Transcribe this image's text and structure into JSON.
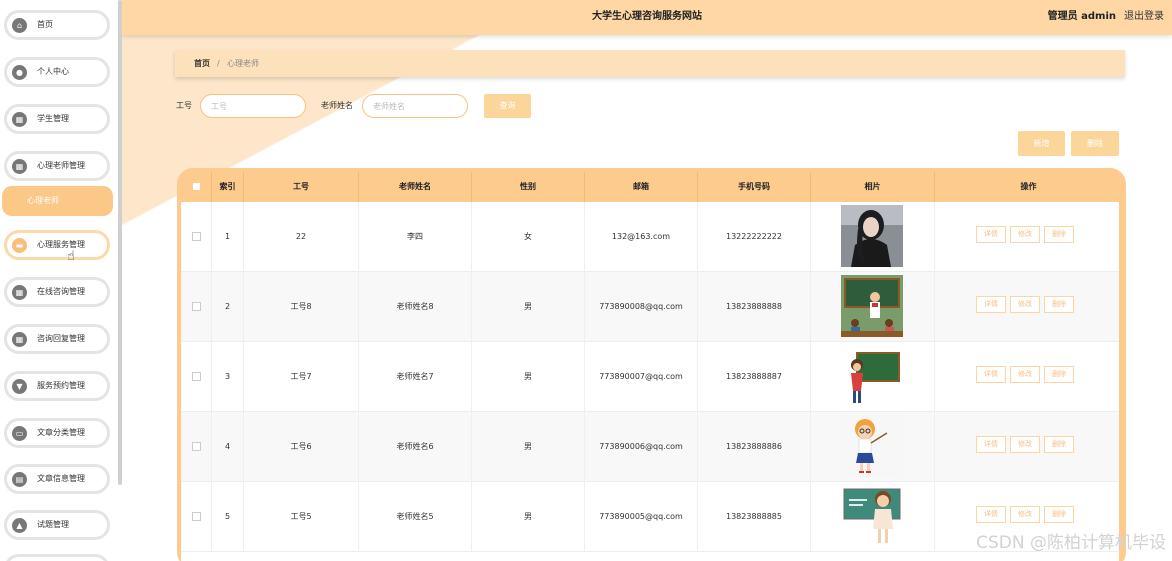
{
  "header": {
    "site_title": "大学生心理咨询服务网站",
    "admin_label": "管理员 admin",
    "logout": "退出登录"
  },
  "sidebar": {
    "items": [
      {
        "label": "首页",
        "icon": "home-icon"
      },
      {
        "label": "个人中心",
        "icon": "user-icon"
      },
      {
        "label": "学生管理",
        "icon": "grid-icon"
      },
      {
        "label": "心理老师管理",
        "icon": "grid-icon"
      },
      {
        "label": "心理服务管理",
        "icon": "chat-icon"
      },
      {
        "label": "在线咨询管理",
        "icon": "grid-icon"
      },
      {
        "label": "咨询回复管理",
        "icon": "grid-icon"
      },
      {
        "label": "服务预约管理",
        "icon": "filter-icon"
      },
      {
        "label": "文章分类管理",
        "icon": "briefcase-icon"
      },
      {
        "label": "文章信息管理",
        "icon": "document-icon"
      },
      {
        "label": "试题管理",
        "icon": "thumb-up-icon"
      }
    ],
    "sub_item": "心理老师"
  },
  "breadcrumb": {
    "home": "首页",
    "separator": "/",
    "current": "心理老师"
  },
  "search": {
    "id_label": "工号",
    "id_placeholder": "工号",
    "name_label": "老师姓名",
    "name_placeholder": "老师姓名",
    "search_button": "查询"
  },
  "toolbar": {
    "add_button": "新增",
    "delete_button": "删除"
  },
  "table": {
    "columns": [
      "索引",
      "工号",
      "老师姓名",
      "性别",
      "邮箱",
      "手机号码",
      "相片",
      "操作"
    ],
    "rows": [
      {
        "index": "1",
        "id": "22",
        "name": "李四",
        "gender": "女",
        "email": "132@163.com",
        "phone": "13222222222"
      },
      {
        "index": "2",
        "id": "工号8",
        "name": "老师姓名8",
        "gender": "男",
        "email": "773890008@qq.com",
        "phone": "13823888888"
      },
      {
        "index": "3",
        "id": "工号7",
        "name": "老师姓名7",
        "gender": "男",
        "email": "773890007@qq.com",
        "phone": "13823888887"
      },
      {
        "index": "4",
        "id": "工号6",
        "name": "老师姓名6",
        "gender": "男",
        "email": "773890006@qq.com",
        "phone": "13823888886"
      },
      {
        "index": "5",
        "id": "工号5",
        "name": "老师姓名5",
        "gender": "男",
        "email": "773890005@qq.com",
        "phone": "13823888885"
      }
    ],
    "actions": {
      "detail": "详情",
      "edit": "修改",
      "delete": "删除"
    }
  },
  "watermark": "CSDN @陈柏计算机毕设",
  "colors": {
    "accent": "#fbc888",
    "header_bg": "#fed7a4",
    "table_frame": "#fdcb8e"
  }
}
